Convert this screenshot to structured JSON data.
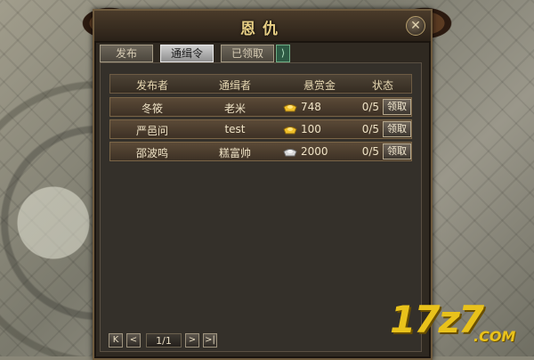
{
  "window": {
    "title": "恩仇",
    "close_symbol": "✕"
  },
  "tabs": [
    {
      "label": "发布",
      "active": false
    },
    {
      "label": "通缉令",
      "active": true
    },
    {
      "label": "已领取",
      "active": false
    }
  ],
  "table": {
    "headers": {
      "publisher": "发布者",
      "target": "通缉者",
      "bounty": "悬赏金",
      "status": "状态"
    },
    "rows": [
      {
        "publisher": "冬筱",
        "target": "老米",
        "bounty": "748",
        "ingot": "gold-ingot-icon",
        "status": "0/5",
        "action": "领取"
      },
      {
        "publisher": "严邑问",
        "target": "test",
        "bounty": "100",
        "ingot": "gold-ingot-icon",
        "status": "0/5",
        "action": "领取"
      },
      {
        "publisher": "邵波鸣",
        "target": "糕富帅",
        "bounty": "2000",
        "ingot": "silver-ingot-icon",
        "status": "0/5",
        "action": "领取"
      }
    ]
  },
  "pager": {
    "first": "K",
    "prev": "<",
    "page": "1/1",
    "next": ">",
    "last": ">|"
  },
  "watermark": {
    "main": "17z7",
    "sub": ".COM"
  },
  "colors": {
    "gold": "#f0c02a",
    "silver": "#d7d7d7",
    "accent": "#e8cf85"
  }
}
